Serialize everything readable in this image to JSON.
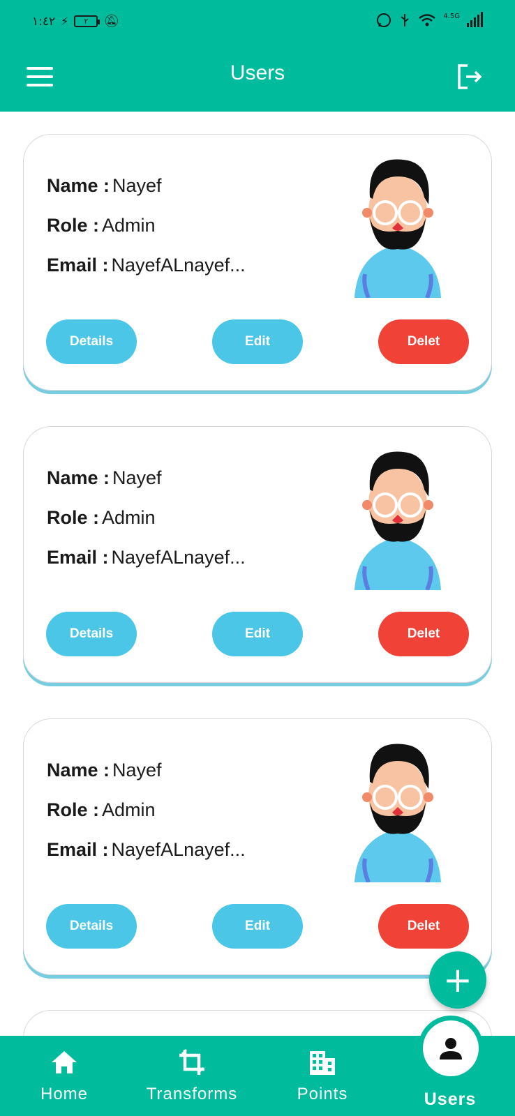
{
  "status_bar": {
    "time": "١:٤٢",
    "battery": "٢",
    "network": "4.5G"
  },
  "app_bar": {
    "title": "Users",
    "menu_icon": "menu-icon",
    "logout_icon": "logout-icon"
  },
  "users": [
    {
      "name_label": "Name :",
      "name": "Nayef",
      "role_label": "Role :",
      "role": "Admin",
      "email_label": "Email :",
      "email": "NayefALnayef...",
      "details_label": "Details",
      "edit_label": "Edit",
      "delete_label": "Delet"
    },
    {
      "name_label": "Name :",
      "name": "Nayef",
      "role_label": "Role :",
      "role": "Admin",
      "email_label": "Email :",
      "email": "NayefALnayef...",
      "details_label": "Details",
      "edit_label": "Edit",
      "delete_label": "Delet"
    },
    {
      "name_label": "Name :",
      "name": "Nayef",
      "role_label": "Role :",
      "role": "Admin",
      "email_label": "Email :",
      "email": "NayefALnayef...",
      "details_label": "Details",
      "edit_label": "Edit",
      "delete_label": "Delet"
    }
  ],
  "fab": {
    "label": "+",
    "icon": "plus-icon"
  },
  "bottom_nav": {
    "items": [
      {
        "label": "Home",
        "icon": "home-icon"
      },
      {
        "label": "Transforms",
        "icon": "crop-icon"
      },
      {
        "label": "Points",
        "icon": "building-icon"
      },
      {
        "label": "Users",
        "icon": "person-icon",
        "active": true
      }
    ]
  },
  "colors": {
    "primary": "#00BC9C",
    "button_blue": "#4BC6E6",
    "button_red": "#F04236"
  }
}
